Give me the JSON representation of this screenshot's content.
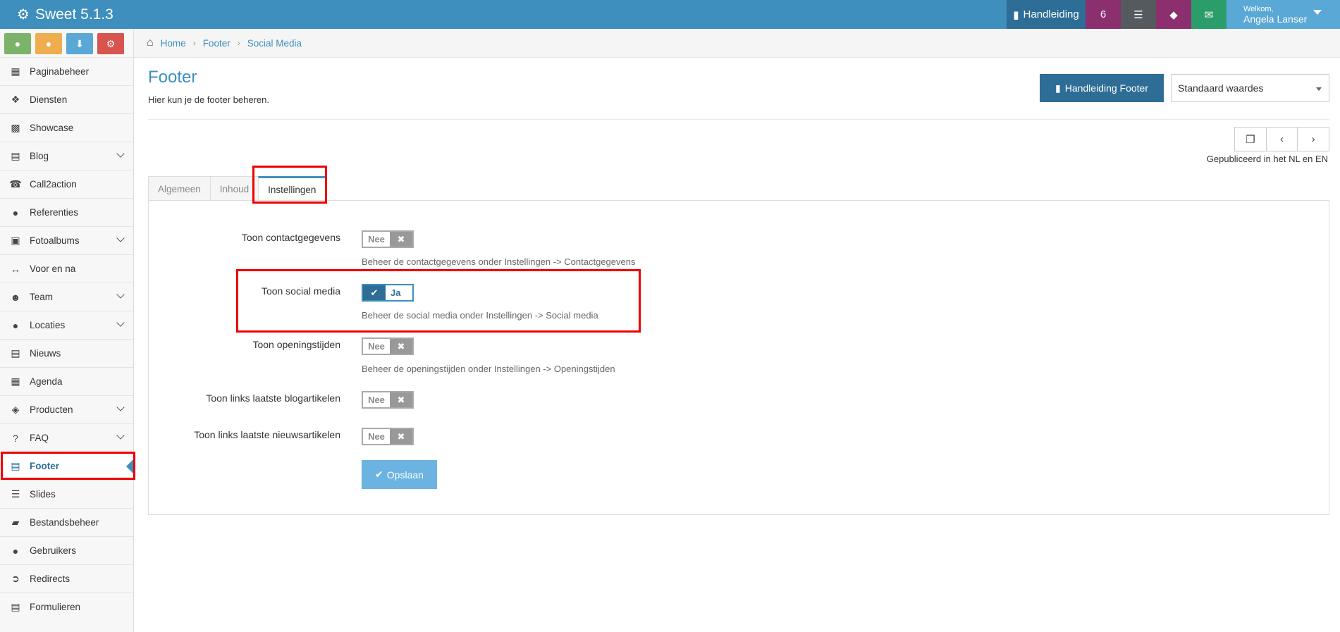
{
  "app": {
    "title": "Sweet 5.1.3"
  },
  "topbar": {
    "manual_label": "Handleiding",
    "notification_count": "6",
    "welcome": "Welkom,",
    "user_name": "Angela Lanser"
  },
  "sidebar": {
    "items": [
      {
        "label": "Paginabeheer",
        "icon": "table-icon",
        "has_children": false
      },
      {
        "label": "Diensten",
        "icon": "cubes-icon",
        "has_children": false
      },
      {
        "label": "Showcase",
        "icon": "grid-icon",
        "has_children": false
      },
      {
        "label": "Blog",
        "icon": "document-icon",
        "has_children": true
      },
      {
        "label": "Call2action",
        "icon": "phone-icon",
        "has_children": false
      },
      {
        "label": "Referenties",
        "icon": "comments-icon",
        "has_children": false
      },
      {
        "label": "Fotoalbums",
        "icon": "album-icon",
        "has_children": true
      },
      {
        "label": "Voor en na",
        "icon": "arrows-horizontal-icon",
        "has_children": false
      },
      {
        "label": "Team",
        "icon": "users-icon",
        "has_children": true
      },
      {
        "label": "Locaties",
        "icon": "map-marker-icon",
        "has_children": true
      },
      {
        "label": "Nieuws",
        "icon": "newspaper-icon",
        "has_children": false
      },
      {
        "label": "Agenda",
        "icon": "calendar-icon",
        "has_children": false
      },
      {
        "label": "Producten",
        "icon": "tags-icon",
        "has_children": true
      },
      {
        "label": "FAQ",
        "icon": "question-icon",
        "has_children": true
      },
      {
        "label": "Footer",
        "icon": "footer-icon",
        "has_children": false,
        "active": true
      },
      {
        "label": "Slides",
        "icon": "sliders-icon",
        "has_children": false
      },
      {
        "label": "Bestandsbeheer",
        "icon": "folder-icon",
        "has_children": false
      },
      {
        "label": "Gebruikers",
        "icon": "user-icon",
        "has_children": false
      },
      {
        "label": "Redirects",
        "icon": "redirect-icon",
        "has_children": false
      },
      {
        "label": "Formulieren",
        "icon": "form-icon",
        "has_children": false
      }
    ]
  },
  "breadcrumb": {
    "home": "Home",
    "section": "Footer",
    "current": "Social Media"
  },
  "page": {
    "title": "Footer",
    "subtitle": "Hier kun je de footer beheren.",
    "manual_button": "Handleiding Footer",
    "preset_select": "Standaard waardes",
    "published": "Gepubliceerd in het NL en EN"
  },
  "tabs": [
    {
      "label": "Algemeen",
      "active": false
    },
    {
      "label": "Inhoud",
      "active": false
    },
    {
      "label": "Instellingen",
      "active": true
    }
  ],
  "form": {
    "rows": [
      {
        "label": "Toon contactgegevens",
        "value": "Nee",
        "on": false,
        "help": "Beheer de contactgegevens onder Instellingen -> Contactgegevens"
      },
      {
        "label": "Toon social media",
        "value": "Ja",
        "on": true,
        "help": "Beheer de social media onder Instellingen -> Social media"
      },
      {
        "label": "Toon openingstijden",
        "value": "Nee",
        "on": false,
        "help": "Beheer de openingstijden onder Instellingen -> Openingstijden"
      },
      {
        "label": "Toon links laatste blogartikelen",
        "value": "Nee",
        "on": false,
        "help": ""
      },
      {
        "label": "Toon links laatste nieuwsartikelen",
        "value": "Nee",
        "on": false,
        "help": ""
      }
    ],
    "save_label": "Opslaan"
  },
  "colors": {
    "primary": "#3e8fbe",
    "dark": "#2d6d96",
    "highlight": "#e00000"
  }
}
